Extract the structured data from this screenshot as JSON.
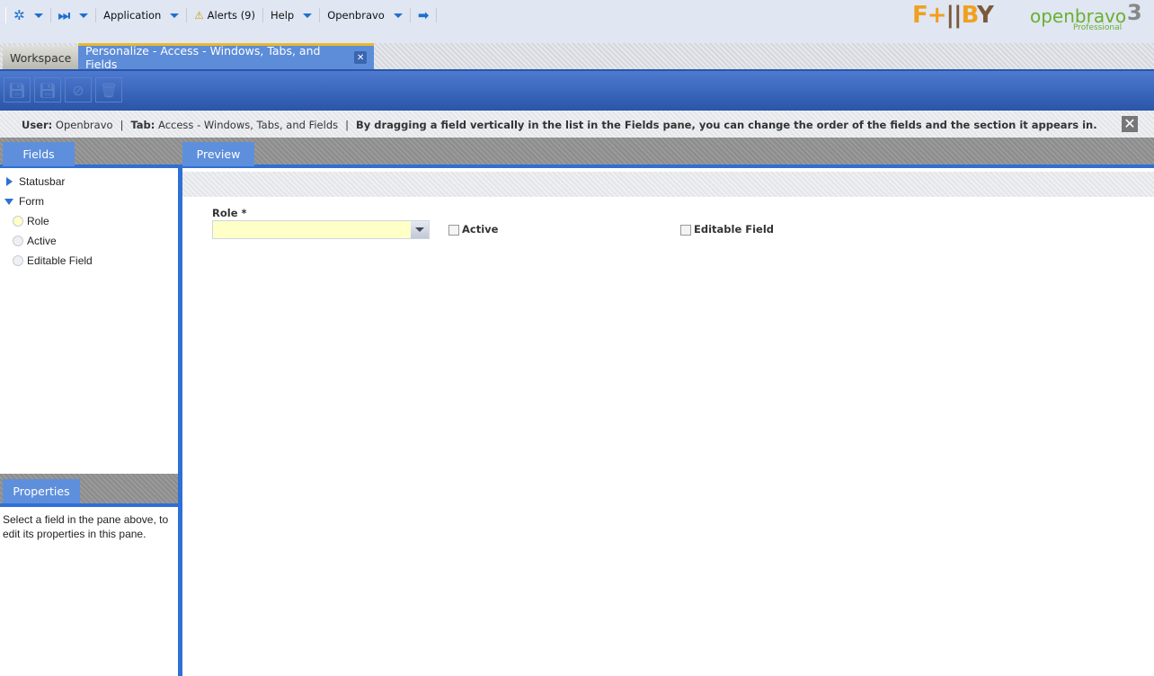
{
  "nav": {
    "application": "Application",
    "alerts": "Alerts (9)",
    "help": "Help",
    "user_menu": "Openbravo"
  },
  "logos": {
    "brand1": "F+B",
    "brand2": "openbravo",
    "brand2_sub": "Professional",
    "brand2_version": "3"
  },
  "tabs": [
    {
      "label": "Workspace"
    },
    {
      "label": "Personalize - Access - Windows, Tabs, and Fields"
    }
  ],
  "info": {
    "user_label": "User:",
    "user_value": "Openbravo",
    "tab_label": "Tab:",
    "tab_value": "Access - Windows, Tabs, and Fields",
    "message": "By dragging a field vertically in the list in the Fields pane, you can change the order of the fields and the section it appears in."
  },
  "panes": {
    "fields": "Fields",
    "preview": "Preview",
    "properties": "Properties"
  },
  "tree": {
    "statusbar": "Statusbar",
    "form": "Form",
    "items": [
      "Role",
      "Active",
      "Editable Field"
    ]
  },
  "properties_text": "Select a field in the pane above, to edit its properties in this pane.",
  "form": {
    "role_label": "Role *",
    "active_label": "Active",
    "editable_label": "Editable Field"
  }
}
